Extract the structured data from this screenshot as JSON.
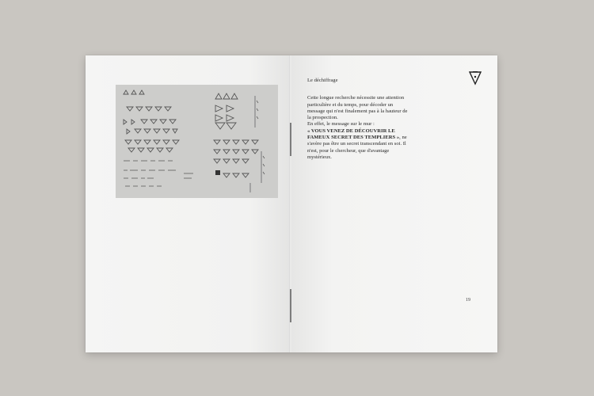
{
  "right_page": {
    "heading": "Le déchiffrage",
    "paragraph_1": "Cette longue recherche nécessite une attention particulière et du temps, pour décoder un message qui n'est finalement pas à la hauteur de la prospection.",
    "paragraph_2_start": "En effet, le message sur le mur :",
    "quote": "« VOUS VENEZ DE DÉCOUVRIR LE FAMEUX SECRET DES TEMPLIERS »",
    "paragraph_2_end": ", ne s'avère pas être un secret transcendant en soi. Il n'est, pour le chercheur, que d'avantage mystérieux.",
    "page_number": "19",
    "logo_icon": "triangle-emblem-icon"
  },
  "left_page": {
    "photo_icon": "cipher-notes-photo"
  }
}
